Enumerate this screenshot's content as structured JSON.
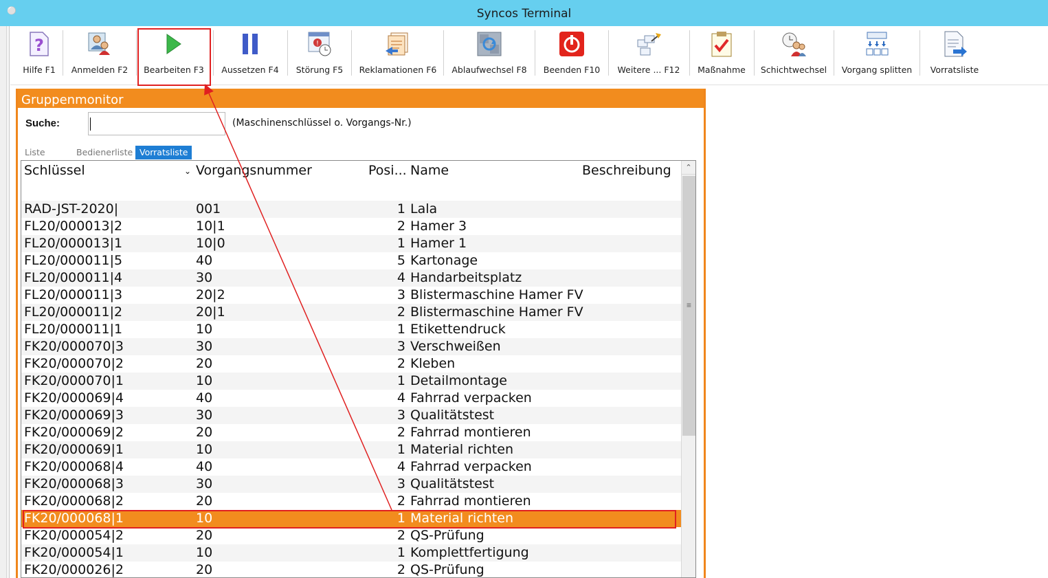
{
  "window": {
    "title": "Syncos Terminal"
  },
  "toolbar": {
    "buttons": [
      {
        "label": "Hilfe F1",
        "icon": "help-icon"
      },
      {
        "label": "Anmelden F2",
        "icon": "login-user-icon"
      },
      {
        "label": "Bearbeiten F3",
        "icon": "play-icon"
      },
      {
        "label": "Aussetzen F4",
        "icon": "pause-icon"
      },
      {
        "label": "Störung F5",
        "icon": "disruption-icon"
      },
      {
        "label": "Reklamationen F6",
        "icon": "complaint-icon"
      },
      {
        "label": "Ablaufwechsel F8",
        "icon": "workflow-change-icon"
      },
      {
        "label": "Beenden F10",
        "icon": "power-icon"
      },
      {
        "label": "Weitere ... F12",
        "icon": "more-icon"
      },
      {
        "label": "Maßnahme",
        "icon": "clipboard-check-icon"
      },
      {
        "label": "Schichtwechsel",
        "icon": "shift-change-icon"
      },
      {
        "label": "Vorgang splitten",
        "icon": "split-icon"
      },
      {
        "label": "Vorratsliste",
        "icon": "document-arrow-icon"
      }
    ]
  },
  "panel": {
    "title": "Gruppenmonitor",
    "search_label": "Suche:",
    "search_value": "",
    "search_hint": "(Maschinenschlüssel o. Vorgangs-Nr.)",
    "tabs": [
      {
        "label": "Liste",
        "active": false
      },
      {
        "label": "Bedienerliste",
        "active": false
      },
      {
        "label": "Vorratsliste",
        "active": true
      }
    ]
  },
  "grid": {
    "columns": [
      "Schlüssel",
      "Vorgangsnummer",
      "Posi...",
      "Name",
      "Beschreibung"
    ],
    "rows": [
      {
        "key": "RAD-JST-2020|",
        "vnr": "001",
        "pos": "1",
        "name": "Lala"
      },
      {
        "key": "FL20/000013|2",
        "vnr": "10|1",
        "pos": "2",
        "name": "Hamer 3"
      },
      {
        "key": "FL20/000013|1",
        "vnr": "10|0",
        "pos": "1",
        "name": "Hamer 1"
      },
      {
        "key": "FL20/000011|5",
        "vnr": "40",
        "pos": "5",
        "name": "Kartonage"
      },
      {
        "key": "FL20/000011|4",
        "vnr": "30",
        "pos": "4",
        "name": "Handarbeitsplatz"
      },
      {
        "key": "FL20/000011|3",
        "vnr": "20|2",
        "pos": "3",
        "name": "Blistermaschine Hamer FV"
      },
      {
        "key": "FL20/000011|2",
        "vnr": "20|1",
        "pos": "2",
        "name": "Blistermaschine Hamer FV"
      },
      {
        "key": "FL20/000011|1",
        "vnr": "10",
        "pos": "1",
        "name": "Etikettendruck"
      },
      {
        "key": "FK20/000070|3",
        "vnr": "30",
        "pos": "3",
        "name": "Verschweißen"
      },
      {
        "key": "FK20/000070|2",
        "vnr": "20",
        "pos": "2",
        "name": "Kleben"
      },
      {
        "key": "FK20/000070|1",
        "vnr": "10",
        "pos": "1",
        "name": "Detailmontage"
      },
      {
        "key": "FK20/000069|4",
        "vnr": "40",
        "pos": "4",
        "name": "Fahrrad verpacken"
      },
      {
        "key": "FK20/000069|3",
        "vnr": "30",
        "pos": "3",
        "name": "Qualitätstest"
      },
      {
        "key": "FK20/000069|2",
        "vnr": "20",
        "pos": "2",
        "name": "Fahrrad montieren"
      },
      {
        "key": "FK20/000069|1",
        "vnr": "10",
        "pos": "1",
        "name": "Material richten"
      },
      {
        "key": "FK20/000068|4",
        "vnr": "40",
        "pos": "4",
        "name": "Fahrrad verpacken"
      },
      {
        "key": "FK20/000068|3",
        "vnr": "30",
        "pos": "3",
        "name": "Qualitätstest"
      },
      {
        "key": "FK20/000068|2",
        "vnr": "20",
        "pos": "2",
        "name": "Fahrrad montieren"
      },
      {
        "key": "FK20/000068|1",
        "vnr": "10",
        "pos": "1",
        "name": "Material richten",
        "selected": true
      },
      {
        "key": "FK20/000054|2",
        "vnr": "20",
        "pos": "2",
        "name": "QS-Prüfung"
      },
      {
        "key": "FK20/000054|1",
        "vnr": "10",
        "pos": "1",
        "name": "Komplettfertigung"
      },
      {
        "key": "FK20/000026|2",
        "vnr": "20",
        "pos": "2",
        "name": "QS-Prüfung"
      }
    ]
  },
  "colors": {
    "titlebar": "#66cfef",
    "accent_orange": "#f28c1e",
    "tab_active": "#1e7ed4",
    "annotation_red": "#e02020"
  }
}
